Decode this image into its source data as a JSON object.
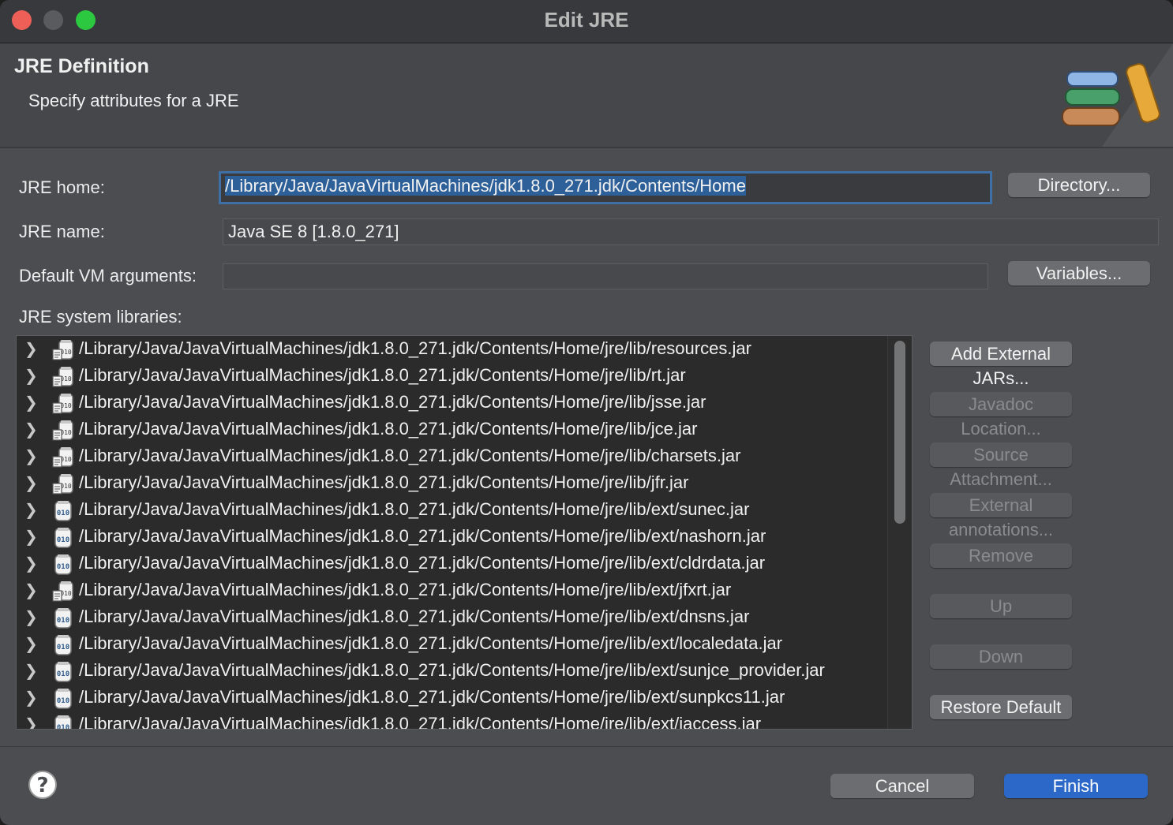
{
  "window": {
    "title": "Edit JRE"
  },
  "header": {
    "title": "JRE Definition",
    "subtitle": "Specify attributes for a JRE",
    "banner_icon": "jre-library-books-icon"
  },
  "form": {
    "jre_home_label": "JRE home:",
    "jre_home_value": "/Library/Java/JavaVirtualMachines/jdk1.8.0_271.jdk/Contents/Home",
    "directory_button": "Directory...",
    "jre_name_label": "JRE name:",
    "jre_name_value": "Java SE 8 [1.8.0_271]",
    "vm_args_label": "Default VM arguments:",
    "vm_args_value": "",
    "variables_button": "Variables...",
    "libraries_label": "JRE system libraries:"
  },
  "libraries": [
    {
      "path": "/Library/Java/JavaVirtualMachines/jdk1.8.0_271.jdk/Contents/Home/jre/lib/resources.jar",
      "icon": "jar-with-source-icon"
    },
    {
      "path": "/Library/Java/JavaVirtualMachines/jdk1.8.0_271.jdk/Contents/Home/jre/lib/rt.jar",
      "icon": "jar-with-source-icon"
    },
    {
      "path": "/Library/Java/JavaVirtualMachines/jdk1.8.0_271.jdk/Contents/Home/jre/lib/jsse.jar",
      "icon": "jar-with-source-icon"
    },
    {
      "path": "/Library/Java/JavaVirtualMachines/jdk1.8.0_271.jdk/Contents/Home/jre/lib/jce.jar",
      "icon": "jar-with-source-icon"
    },
    {
      "path": "/Library/Java/JavaVirtualMachines/jdk1.8.0_271.jdk/Contents/Home/jre/lib/charsets.jar",
      "icon": "jar-with-source-icon"
    },
    {
      "path": "/Library/Java/JavaVirtualMachines/jdk1.8.0_271.jdk/Contents/Home/jre/lib/jfr.jar",
      "icon": "jar-with-source-icon"
    },
    {
      "path": "/Library/Java/JavaVirtualMachines/jdk1.8.0_271.jdk/Contents/Home/jre/lib/ext/sunec.jar",
      "icon": "jar-icon"
    },
    {
      "path": "/Library/Java/JavaVirtualMachines/jdk1.8.0_271.jdk/Contents/Home/jre/lib/ext/nashorn.jar",
      "icon": "jar-icon"
    },
    {
      "path": "/Library/Java/JavaVirtualMachines/jdk1.8.0_271.jdk/Contents/Home/jre/lib/ext/cldrdata.jar",
      "icon": "jar-icon"
    },
    {
      "path": "/Library/Java/JavaVirtualMachines/jdk1.8.0_271.jdk/Contents/Home/jre/lib/ext/jfxrt.jar",
      "icon": "jar-with-source-icon"
    },
    {
      "path": "/Library/Java/JavaVirtualMachines/jdk1.8.0_271.jdk/Contents/Home/jre/lib/ext/dnsns.jar",
      "icon": "jar-icon"
    },
    {
      "path": "/Library/Java/JavaVirtualMachines/jdk1.8.0_271.jdk/Contents/Home/jre/lib/ext/localedata.jar",
      "icon": "jar-icon"
    },
    {
      "path": "/Library/Java/JavaVirtualMachines/jdk1.8.0_271.jdk/Contents/Home/jre/lib/ext/sunjce_provider.jar",
      "icon": "jar-icon"
    },
    {
      "path": "/Library/Java/JavaVirtualMachines/jdk1.8.0_271.jdk/Contents/Home/jre/lib/ext/sunpkcs11.jar",
      "icon": "jar-icon"
    },
    {
      "path": "/Library/Java/JavaVirtualMachines/jdk1.8.0_271.jdk/Contents/Home/jre/lib/ext/jaccess.jar",
      "icon": "jar-icon"
    }
  ],
  "library_buttons": {
    "add_external_jars": "Add External JARs...",
    "javadoc_location": "Javadoc Location...",
    "source_attachment": "Source Attachment...",
    "external_annotations": "External annotations...",
    "remove": "Remove",
    "up": "Up",
    "down": "Down",
    "restore_default": "Restore Default"
  },
  "footer": {
    "help_icon": "help-icon",
    "cancel": "Cancel",
    "finish": "Finish"
  },
  "colors": {
    "accent": "#2b68c8",
    "focus_border": "#3e6fa5",
    "close": "#ee5f57",
    "maximize": "#2bc840"
  }
}
